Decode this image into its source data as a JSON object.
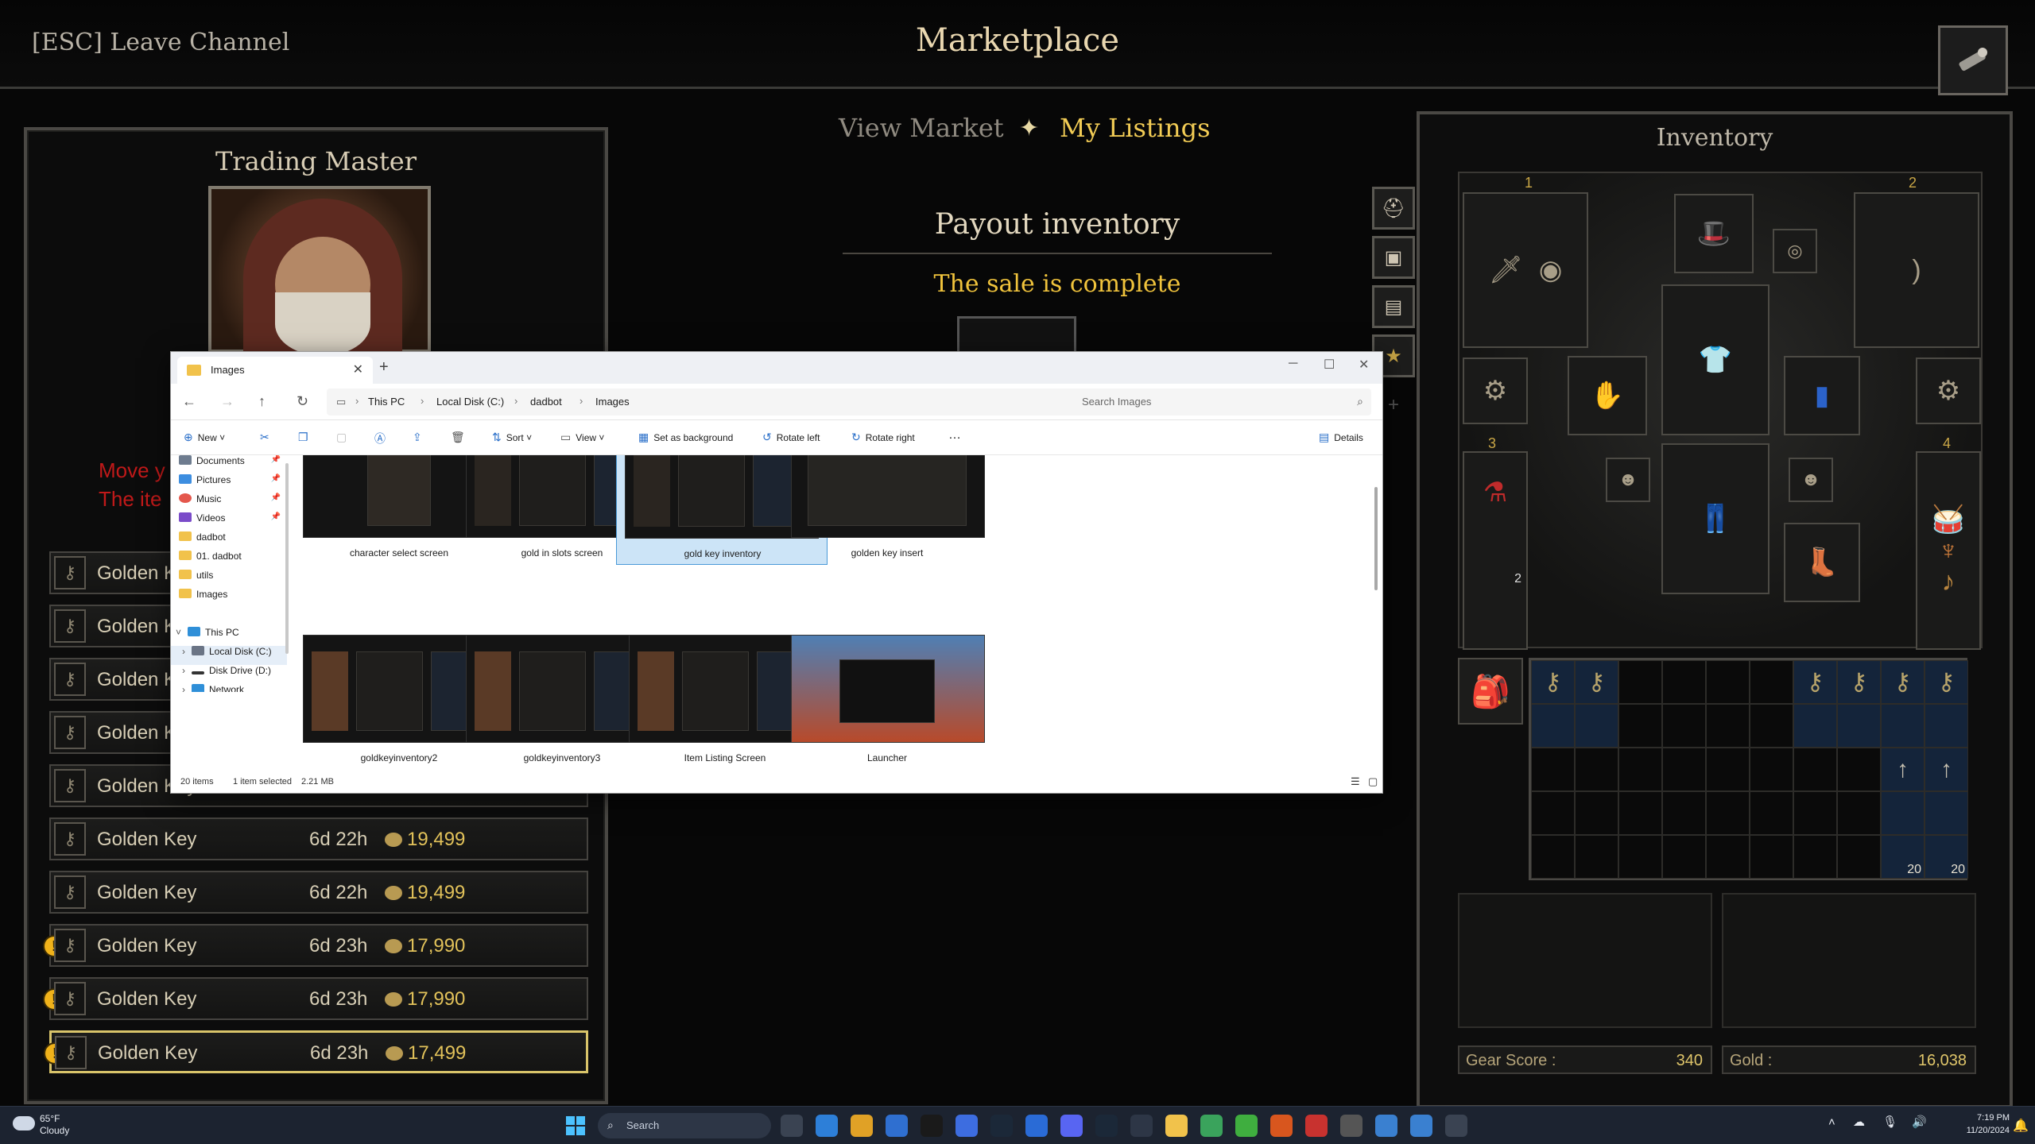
{
  "game": {
    "esc_label": "[ESC] Leave Channel",
    "title": "Marketplace",
    "tabs": {
      "view_market": "View Market",
      "my_listings": "My Listings"
    },
    "payout_title": "Payout inventory",
    "sale_status": "The sale is complete"
  },
  "trader": {
    "title": "Trading Master",
    "warning_line1": "Move y",
    "warning_line2": "The ite"
  },
  "listings": [
    {
      "name": "Golden Key",
      "time": "",
      "price": "",
      "warning": false,
      "selected": false
    },
    {
      "name": "Golden Key",
      "time": "",
      "price": "",
      "warning": false,
      "selected": false
    },
    {
      "name": "Golden Key",
      "time": "",
      "price": "",
      "warning": false,
      "selected": false
    },
    {
      "name": "Golden Key",
      "time": "",
      "price": "",
      "warning": false,
      "selected": false
    },
    {
      "name": "Golden Key",
      "time": "",
      "price": "",
      "warning": false,
      "selected": false
    },
    {
      "name": "Golden Key",
      "time": "6d 22h",
      "price": "19,499",
      "warning": false,
      "selected": false
    },
    {
      "name": "Golden Key",
      "time": "6d 22h",
      "price": "19,499",
      "warning": false,
      "selected": false
    },
    {
      "name": "Golden Key",
      "time": "6d 23h",
      "price": "17,990",
      "warning": true,
      "selected": false
    },
    {
      "name": "Golden Key",
      "time": "6d 23h",
      "price": "17,990",
      "warning": true,
      "selected": false
    },
    {
      "name": "Golden Key",
      "time": "6d 23h",
      "price": "17,499",
      "warning": true,
      "selected": true
    }
  ],
  "inventory": {
    "title": "Inventory",
    "slot_numbers": [
      "1",
      "2",
      "3",
      "4"
    ],
    "belt_count": "2",
    "arrow_count": "20",
    "gear_score_label": "Gear Score :",
    "gear_score": "340",
    "gold_label": "Gold :",
    "gold": "16,038"
  },
  "explorer": {
    "tab_title": "Images",
    "breadcrumb": [
      "This PC",
      "Local Disk (C:)",
      "dadbot",
      "Images"
    ],
    "search_placeholder": "Search Images",
    "toolbar": {
      "new": "New",
      "sort": "Sort",
      "view": "View",
      "set_background": "Set as background",
      "rotate_left": "Rotate left",
      "rotate_right": "Rotate right",
      "more": "…",
      "details": "Details"
    },
    "nav": {
      "documents": "Documents",
      "pictures": "Pictures",
      "music": "Music",
      "videos": "Videos",
      "dadbot": "dadbot",
      "dadbot2": "01. dadbot",
      "utils": "utils",
      "images": "Images",
      "this_pc": "This PC",
      "local_disk": "Local Disk (C:)",
      "disk_drive": "Disk Drive (D:)",
      "network": "Network"
    },
    "files": [
      "character select screen",
      "gold in slots screen",
      "gold key inventory",
      "golden key insert",
      "goldkeyinventory2",
      "goldkeyinventory3",
      "Item Listing Screen",
      "Launcher"
    ],
    "status": {
      "count": "20 items",
      "selection": "1 item selected",
      "size": "2.21 MB"
    }
  },
  "taskbar": {
    "temp": "65°F",
    "condition": "Cloudy",
    "search": "Search",
    "time": "7:19 PM",
    "date": "11/20/2024"
  },
  "colors": {
    "accent_gold": "#f0c33c",
    "warning_red": "#c01919",
    "win_blue": "#4cc2ff"
  }
}
